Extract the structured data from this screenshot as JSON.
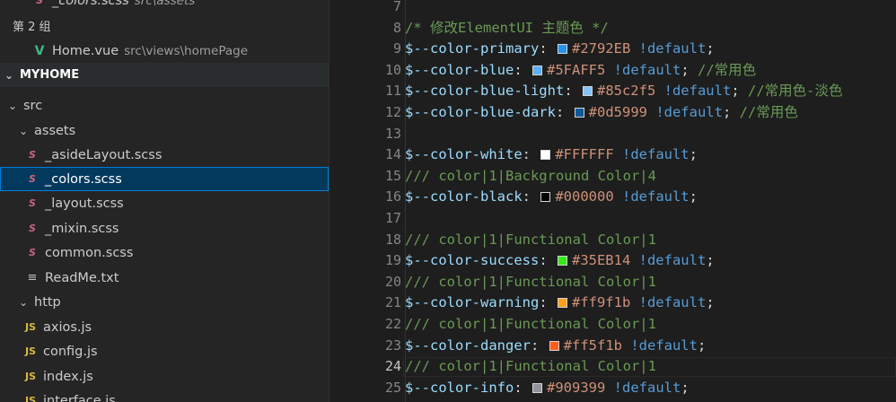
{
  "sidebar": {
    "open_editors_top": {
      "name": "_colors.scss",
      "desc": "src\\assets"
    },
    "group2_label": "第 2 组",
    "group2_file": {
      "name": "Home.vue",
      "desc": "src\\views\\homePage"
    },
    "explorer_title": "MYHOME",
    "tree": {
      "src": "src",
      "assets": "assets",
      "files_assets": [
        "_asideLayout.scss",
        "_colors.scss",
        "_layout.scss",
        "_mixin.scss",
        "common.scss"
      ],
      "readme": "ReadMe.txt",
      "http": "http",
      "files_http": [
        "axios.js",
        "config.js",
        "index.js",
        "interface.js"
      ]
    },
    "icons": {
      "scss": "S",
      "js": "JS",
      "vue": "V",
      "txt": "≡"
    }
  },
  "editor": {
    "lines": [
      {
        "n": "7",
        "parts": []
      },
      {
        "n": "8",
        "parts": [
          {
            "t": "/* 修改ElementUI 主题色 */",
            "c": "comment"
          }
        ]
      },
      {
        "n": "9",
        "parts": [
          {
            "t": "$--color-primary",
            "c": "var"
          },
          {
            "t": ": ",
            "c": "punc"
          },
          {
            "sw": "#2792EB"
          },
          {
            "t": "#2792EB",
            "c": "val"
          },
          {
            "t": " !default",
            "c": "imp"
          },
          {
            "t": ";",
            "c": "punc"
          }
        ]
      },
      {
        "n": "10",
        "parts": [
          {
            "t": "$--color-blue",
            "c": "var"
          },
          {
            "t": ": ",
            "c": "punc"
          },
          {
            "sw": "#5FAFF5"
          },
          {
            "t": "#5FAFF5",
            "c": "val"
          },
          {
            "t": " !default",
            "c": "imp"
          },
          {
            "t": "; ",
            "c": "punc"
          },
          {
            "t": "//常用色",
            "c": "comment"
          }
        ]
      },
      {
        "n": "11",
        "parts": [
          {
            "t": "$--color-blue-light",
            "c": "var"
          },
          {
            "t": ": ",
            "c": "punc"
          },
          {
            "sw": "#85c2f5"
          },
          {
            "t": "#85c2f5",
            "c": "val"
          },
          {
            "t": " !default",
            "c": "imp"
          },
          {
            "t": "; ",
            "c": "punc"
          },
          {
            "t": "//常用色-淡色",
            "c": "comment"
          }
        ]
      },
      {
        "n": "12",
        "parts": [
          {
            "t": "$--color-blue-dark",
            "c": "var"
          },
          {
            "t": ": ",
            "c": "punc"
          },
          {
            "sw": "#0d5999"
          },
          {
            "t": "#0d5999",
            "c": "val"
          },
          {
            "t": " !default",
            "c": "imp"
          },
          {
            "t": "; ",
            "c": "punc"
          },
          {
            "t": "//常用色",
            "c": "comment"
          }
        ]
      },
      {
        "n": "13",
        "parts": []
      },
      {
        "n": "14",
        "parts": [
          {
            "t": "$--color-white",
            "c": "var"
          },
          {
            "t": ": ",
            "c": "punc"
          },
          {
            "sw": "#FFFFFF"
          },
          {
            "t": "#FFFFFF",
            "c": "val"
          },
          {
            "t": " !default",
            "c": "imp"
          },
          {
            "t": ";",
            "c": "punc"
          }
        ]
      },
      {
        "n": "15",
        "parts": [
          {
            "t": "/// color|1|Background Color|4",
            "c": "comment"
          }
        ]
      },
      {
        "n": "16",
        "parts": [
          {
            "t": "$--color-black",
            "c": "var"
          },
          {
            "t": ": ",
            "c": "punc"
          },
          {
            "sw": "#000000"
          },
          {
            "t": "#000000",
            "c": "val"
          },
          {
            "t": " !default",
            "c": "imp"
          },
          {
            "t": ";",
            "c": "punc"
          }
        ]
      },
      {
        "n": "17",
        "parts": []
      },
      {
        "n": "18",
        "parts": [
          {
            "t": "/// color|1|Functional Color|1",
            "c": "comment"
          }
        ]
      },
      {
        "n": "19",
        "parts": [
          {
            "t": "$--color-success",
            "c": "var"
          },
          {
            "t": ": ",
            "c": "punc"
          },
          {
            "sw": "#35EB14"
          },
          {
            "t": "#35EB14",
            "c": "val"
          },
          {
            "t": " !default",
            "c": "imp"
          },
          {
            "t": ";",
            "c": "punc"
          }
        ]
      },
      {
        "n": "20",
        "parts": [
          {
            "t": "/// color|1|Functional Color|1",
            "c": "comment"
          }
        ]
      },
      {
        "n": "21",
        "parts": [
          {
            "t": "$--color-warning",
            "c": "var"
          },
          {
            "t": ": ",
            "c": "punc"
          },
          {
            "sw": "#ff9f1b"
          },
          {
            "t": "#ff9f1b",
            "c": "val"
          },
          {
            "t": " !default",
            "c": "imp"
          },
          {
            "t": ";",
            "c": "punc"
          }
        ]
      },
      {
        "n": "22",
        "parts": [
          {
            "t": "/// color|1|Functional Color|1",
            "c": "comment"
          }
        ]
      },
      {
        "n": "23",
        "parts": [
          {
            "t": "$--color-danger",
            "c": "var"
          },
          {
            "t": ": ",
            "c": "punc"
          },
          {
            "sw": "#ff5f1b"
          },
          {
            "t": "#ff5f1b",
            "c": "val"
          },
          {
            "t": " !default",
            "c": "imp"
          },
          {
            "t": ";",
            "c": "punc"
          }
        ]
      },
      {
        "n": "24",
        "parts": [
          {
            "t": "/// color|1|Functional Color|1",
            "c": "comment"
          }
        ],
        "active": true
      },
      {
        "n": "25",
        "parts": [
          {
            "t": "$--color-info",
            "c": "var"
          },
          {
            "t": ": ",
            "c": "punc"
          },
          {
            "sw": "#909399"
          },
          {
            "t": "#909399",
            "c": "val"
          },
          {
            "t": " !default",
            "c": "imp"
          },
          {
            "t": ";",
            "c": "punc"
          }
        ]
      }
    ]
  },
  "colors": {
    "selection": "#04395e",
    "scss_icon": "#c5667f",
    "vue_icon": "#41b883",
    "js_icon": "#d7ba3f"
  }
}
